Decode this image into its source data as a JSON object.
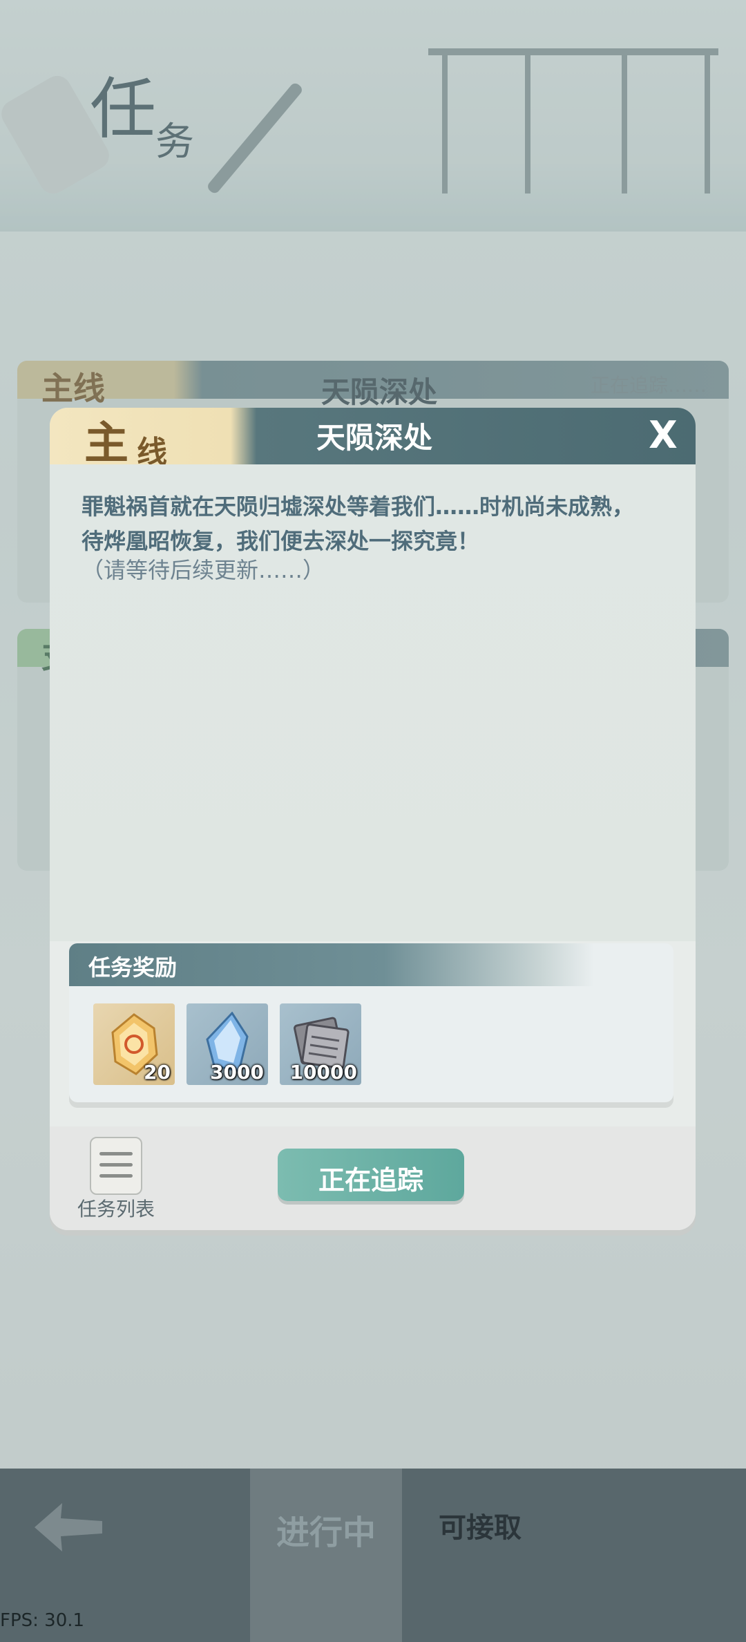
{
  "screen": {
    "page_title_char1": "任",
    "page_title_char2": "务"
  },
  "background_cards": [
    {
      "tag": "主线",
      "title": "天陨深处",
      "status": "正在追踪……"
    },
    {
      "tag": "支",
      "title": "",
      "status": ""
    }
  ],
  "dialog": {
    "tag_main": "主",
    "tag_sub": "线",
    "title": "天陨深处",
    "close_label": "X",
    "description_lines": [
      "罪魁祸首就在天陨归墟深处等着我们……时机尚未成熟，",
      "待烨凰昭恢复，我们便去深处一探究竟！"
    ],
    "note": "（请等待后续更新……）",
    "rewards": {
      "title": "任务奖励",
      "items": [
        {
          "icon": "amber-gem-icon",
          "count": "20"
        },
        {
          "icon": "blue-crystal-icon",
          "count": "3000"
        },
        {
          "icon": "scroll-bundle-icon",
          "count": "10000"
        }
      ]
    },
    "task_list_label": "任务列表",
    "tracking_button": "正在追踪"
  },
  "bottom_nav": {
    "tabs": [
      {
        "label": "进行中",
        "active": true
      },
      {
        "label": "可接取",
        "active": false
      }
    ]
  },
  "fps": "FPS: 30.1"
}
